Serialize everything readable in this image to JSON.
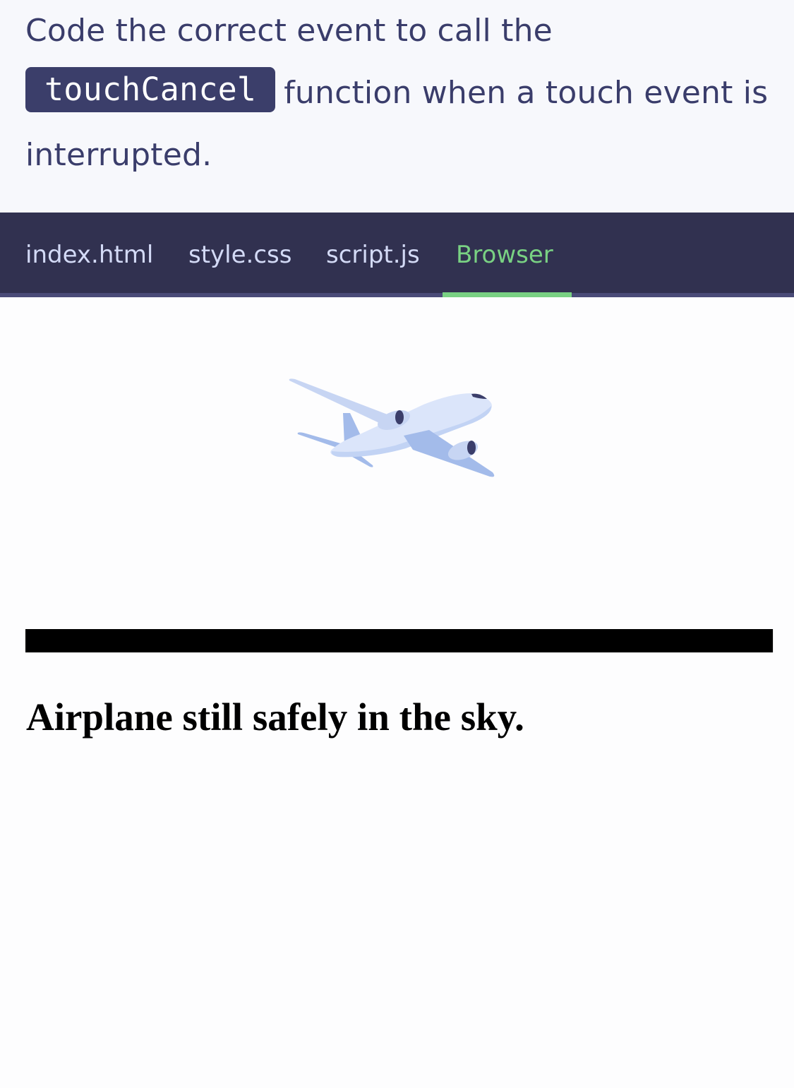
{
  "instruction": {
    "text_before": "Code the correct event to call the",
    "code": "touchCancel",
    "text_after": "function when a touch event is interrupted."
  },
  "tabs": [
    {
      "label": "index.html",
      "active": false
    },
    {
      "label": "style.css",
      "active": false
    },
    {
      "label": "script.js",
      "active": false
    },
    {
      "label": "Browser",
      "active": true
    }
  ],
  "browser": {
    "status_text": "Airplane still safely in the sky.",
    "image_icon": "airplane-icon"
  },
  "colors": {
    "instruction_bg": "#f7f8fc",
    "instruction_text": "#3a3d6b",
    "code_pill_bg": "#3b3e6a",
    "tabbar_bg": "#313150",
    "tab_text": "#d3daf6",
    "tab_active": "#79d183"
  }
}
